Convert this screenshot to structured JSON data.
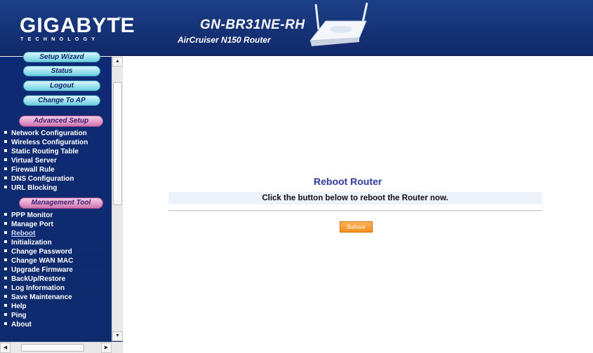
{
  "header": {
    "logo": "GIGABYTE",
    "logo_tm": "™",
    "logo_sub": "TECHNOLOGY",
    "model": "GN-BR31NE-RH",
    "submodel": "AirCruiser N150 Router"
  },
  "sidebar": {
    "buttons": [
      {
        "label": "Setup Wizard"
      },
      {
        "label": "Status"
      },
      {
        "label": "Logout"
      },
      {
        "label": "Change To AP"
      }
    ],
    "advanced_setup": {
      "title": "Advanced Setup",
      "items": [
        {
          "label": "Network Configuration"
        },
        {
          "label": "Wireless Configuration"
        },
        {
          "label": "Static Routing Table"
        },
        {
          "label": "Virtual Server"
        },
        {
          "label": "Firewall Rule"
        },
        {
          "label": "DNS Configuration"
        },
        {
          "label": "URL Blocking"
        }
      ]
    },
    "management_tool": {
      "title": "Management Tool",
      "items": [
        {
          "label": "PPP Monitor"
        },
        {
          "label": "Manage Port"
        },
        {
          "label": "Reboot"
        },
        {
          "label": "Initialization"
        },
        {
          "label": "Change Password"
        },
        {
          "label": "Change WAN MAC"
        },
        {
          "label": "Upgrade Firmware"
        },
        {
          "label": "BackUp/Restore"
        },
        {
          "label": "Log Information"
        },
        {
          "label": "Save Maintenance"
        },
        {
          "label": "Help"
        },
        {
          "label": "Ping"
        },
        {
          "label": "About"
        }
      ]
    }
  },
  "main": {
    "title": "Reboot Router",
    "instruction": "Click the button below to reboot the Router now.",
    "reboot_button": "Reboot"
  },
  "colors": {
    "header_bg": "#173579",
    "sidebar_bg": "#0f2a74",
    "title": "#2e3a9b",
    "button_orange": "#f48f1e"
  }
}
